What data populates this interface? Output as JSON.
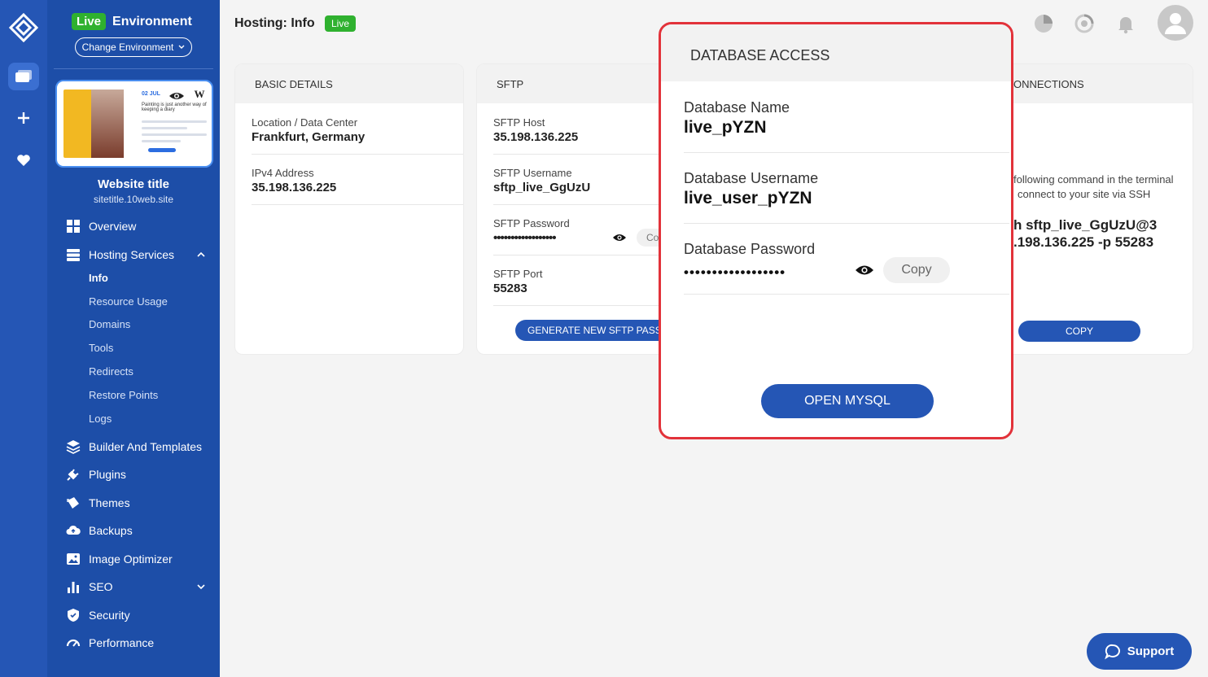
{
  "environment": {
    "badge": "Live",
    "label": "Environment",
    "change_button": "Change Environment"
  },
  "website": {
    "title": "Website title",
    "url": "sitetitle.10web.site",
    "preview": {
      "date": "02 JUL",
      "text": "Painting is just another way of keeping a diary"
    }
  },
  "nav": {
    "overview": "Overview",
    "hosting_services": "Hosting Services",
    "sub": [
      "Info",
      "Resource Usage",
      "Domains",
      "Tools",
      "Redirects",
      "Restore Points",
      "Logs"
    ],
    "builder": "Builder And Templates",
    "plugins": "Plugins",
    "themes": "Themes",
    "backups": "Backups",
    "image_optimizer": "Image Optimizer",
    "seo": "SEO",
    "security": "Security",
    "performance": "Performance"
  },
  "header": {
    "title": "Hosting: Info",
    "badge": "Live"
  },
  "basic": {
    "heading": "BASIC DETAILS",
    "location_label": "Location / Data Center",
    "location_value": "Frankfurt, Germany",
    "ip_label": "IPv4 Address",
    "ip_value": "35.198.136.225"
  },
  "sftp": {
    "heading": "SFTP",
    "host_label": "SFTP Host",
    "host_value": "35.198.136.225",
    "user_label": "SFTP Username",
    "user_value": "sftp_live_GgUzU",
    "pass_label": "SFTP Password",
    "pass_value": "••••••••••••••••••",
    "copy_partial": "Co",
    "port_label": "SFTP Port",
    "port_value": "55283",
    "generate_button": "GENERATE NEW SFTP PASSWO"
  },
  "ssh": {
    "heading": "ONNECTIONS",
    "desc_line1": "following command in the terminal",
    "desc_line2": "connect to your site via SSH",
    "cmd_line1": "h sftp_live_GgUzU@3",
    "cmd_line2": ".198.136.225 -p 55283",
    "copy_button": "COPY"
  },
  "modal": {
    "heading": "DATABASE ACCESS",
    "name_label": "Database Name",
    "name_value": "live_pYZN",
    "user_label": "Database Username",
    "user_value": "live_user_pYZN",
    "pass_label": "Database Password",
    "pass_value": "••••••••••••••••••",
    "copy_button": "Copy",
    "open_button": "OPEN MYSQL"
  },
  "support": "Support",
  "colors": {
    "primary": "#2556b5",
    "sidebar": "#1d4ea8",
    "live": "#2fb12f",
    "highlight": "#e2323a"
  }
}
